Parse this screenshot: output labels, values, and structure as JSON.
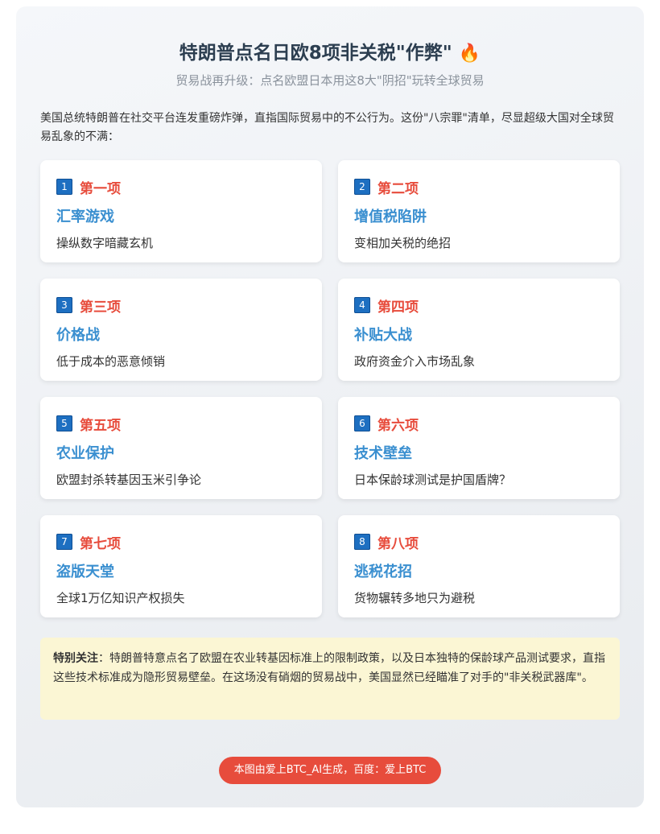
{
  "header": {
    "title": "特朗普点名日欧8项非关税\"作弊\"",
    "title_icon": "🔥",
    "subtitle": "贸易战再升级：点名欧盟日本用这8大\"阴招\"玩转全球贸易"
  },
  "intro": "美国总统特朗普在社交平台连发重磅炸弹，直指国际贸易中的不公行为。这份\"八宗罪\"清单，尽显超级大国对全球贸易乱象的不满：",
  "items": [
    {
      "num": "1",
      "rank": "第一项",
      "name": "汇率游戏",
      "desc": "操纵数字暗藏玄机"
    },
    {
      "num": "2",
      "rank": "第二项",
      "name": "增值税陷阱",
      "desc": "变相加关税的绝招"
    },
    {
      "num": "3",
      "rank": "第三项",
      "name": "价格战",
      "desc": "低于成本的恶意倾销"
    },
    {
      "num": "4",
      "rank": "第四项",
      "name": "补贴大战",
      "desc": "政府资金介入市场乱象"
    },
    {
      "num": "5",
      "rank": "第五项",
      "name": "农业保护",
      "desc": "欧盟封杀转基因玉米引争论"
    },
    {
      "num": "6",
      "rank": "第六项",
      "name": "技术壁垒",
      "desc": "日本保龄球测试是护国盾牌？"
    },
    {
      "num": "7",
      "rank": "第七项",
      "name": "盗版天堂",
      "desc": "全球1万亿知识产权损失"
    },
    {
      "num": "8",
      "rank": "第八项",
      "name": "逃税花招",
      "desc": "货物辗转多地只为避税"
    }
  ],
  "note": {
    "label": "特别关注",
    "text": "：特朗普特意点名了欧盟在农业转基因标准上的限制政策，以及日本独特的保龄球产品测试要求，直指这些技术标准成为隐形贸易壁垒。在这场没有硝烟的贸易战中，美国显然已经瞄准了对手的\"非关税武器库\"。"
  },
  "footer": {
    "badge": "本图由爱上BTC_AI生成，百度：爱上BTC"
  },
  "colors": {
    "rank": "#e74c3c",
    "name": "#3a8fd0",
    "number_badge": "#1d6fc1",
    "note_bg": "#fbf6d4",
    "footer_badge": "#e74c3c"
  }
}
